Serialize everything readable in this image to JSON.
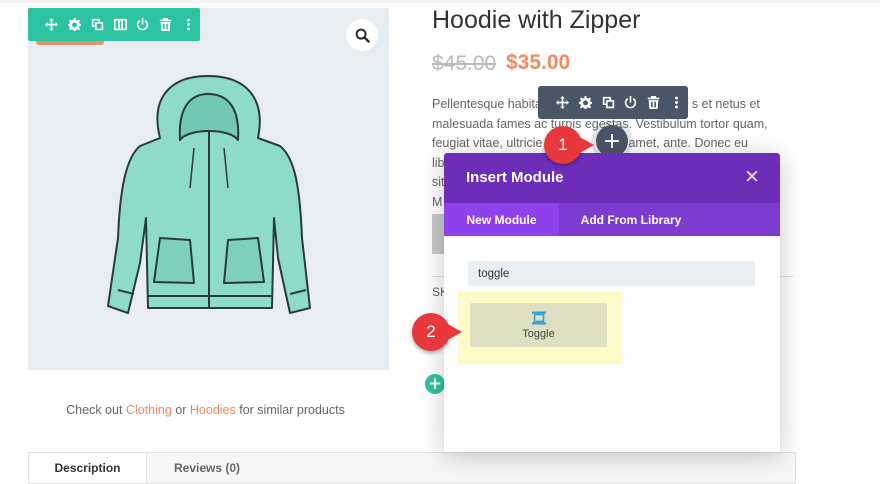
{
  "product": {
    "title": "Hoodie with Zipper",
    "old_price": "$45.00",
    "new_price": "$35.00",
    "description_lines": [
      "Pellentesque habita",
      "s et netus et",
      "malesuada fames ac turpis egestas. Vestibulum tortor quam,",
      "feugiat vitae, ultricie",
      "sit amet, ante. Donec eu libero",
      "sit",
      "M"
    ],
    "sku_label": "SK",
    "caption_prefix": "Check out",
    "caption_link1": "Clothing",
    "caption_mid": "or",
    "caption_link2": "Hoodies",
    "caption_suffix": "for similar products",
    "tabs": [
      "Description",
      "Reviews (0)"
    ]
  },
  "toolbar_icons": [
    "move-icon",
    "gear-icon",
    "duplicate-icon",
    "columns-icon",
    "power-icon",
    "trash-icon",
    "more-icon"
  ],
  "row_toolbar_icons": [
    "move-icon",
    "gear-icon",
    "duplicate-icon",
    "power-icon",
    "trash-icon",
    "more-icon"
  ],
  "modal": {
    "title": "Insert Module",
    "close": "×",
    "tabs": [
      "New Module",
      "Add From Library"
    ],
    "search_value": "toggle",
    "result_label": "Toggle"
  },
  "markers": [
    "1",
    "2"
  ],
  "add_symbol": "+",
  "colors": {
    "builder_green": "#2cc4a0",
    "builder_dark": "#4a5567",
    "modal_purple": "#6c2eb9",
    "modal_tab_purple": "#7e3bd0",
    "price_orange": "#f08a5d",
    "marker_red": "#e8383d",
    "highlight_yellow": "#fdfbc8"
  }
}
